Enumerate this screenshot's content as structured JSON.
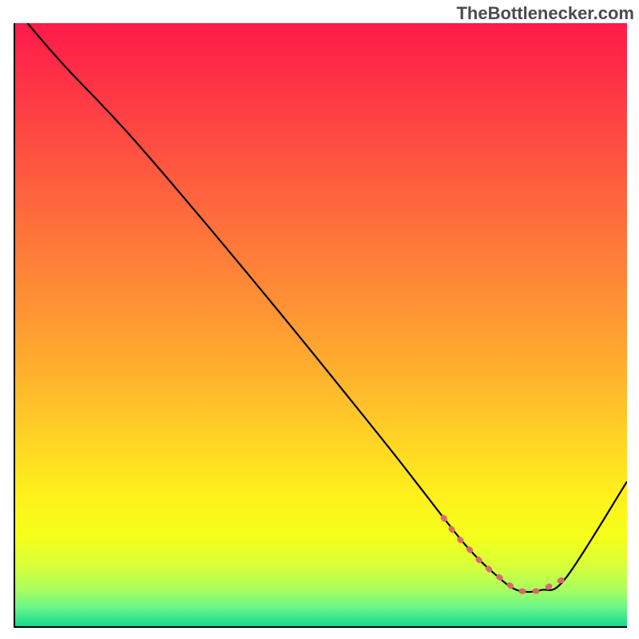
{
  "watermark": "TheBottlenecker.com",
  "chart_data": {
    "type": "line",
    "title": "",
    "xlabel": "",
    "ylabel": "",
    "xlim": [
      0,
      100
    ],
    "ylim": [
      0,
      100
    ],
    "series": [
      {
        "name": "bottleneck-curve",
        "color": "#000000",
        "x": [
          2,
          8,
          20,
          40,
          60,
          70,
          74,
          78,
          82,
          86,
          90,
          100
        ],
        "y": [
          100,
          93,
          80,
          56,
          31,
          18,
          13,
          9,
          6,
          6,
          8,
          24
        ]
      },
      {
        "name": "optimal-zone-marker",
        "color": "#da6a6a",
        "style": "dotted",
        "x": [
          70,
          72,
          74,
          76,
          78,
          80,
          82,
          84,
          86,
          88,
          90
        ],
        "y": [
          18,
          15.2,
          13,
          10.8,
          9,
          7.5,
          6,
          5.8,
          6,
          7,
          8
        ]
      }
    ],
    "background_gradient": {
      "stops": [
        {
          "offset": 0.0,
          "color": "#ff1a4a"
        },
        {
          "offset": 0.1,
          "color": "#ff3346"
        },
        {
          "offset": 0.25,
          "color": "#ff5a3f"
        },
        {
          "offset": 0.4,
          "color": "#ff8038"
        },
        {
          "offset": 0.55,
          "color": "#ffa82f"
        },
        {
          "offset": 0.68,
          "color": "#ffd026"
        },
        {
          "offset": 0.78,
          "color": "#fff01c"
        },
        {
          "offset": 0.85,
          "color": "#f6ff1a"
        },
        {
          "offset": 0.9,
          "color": "#d8ff3a"
        },
        {
          "offset": 0.94,
          "color": "#a8ff60"
        },
        {
          "offset": 0.97,
          "color": "#66f58a"
        },
        {
          "offset": 1.0,
          "color": "#14d98f"
        }
      ]
    }
  }
}
